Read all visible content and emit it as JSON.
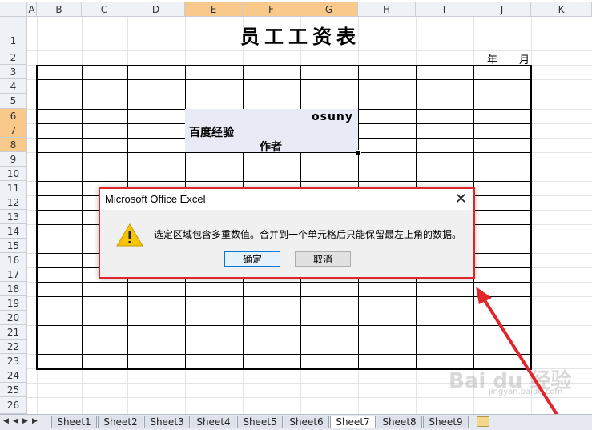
{
  "columns": [
    "A",
    "B",
    "C",
    "D",
    "E",
    "F",
    "G",
    "H",
    "I",
    "J",
    "K"
  ],
  "selected_columns": [
    "E",
    "F",
    "G"
  ],
  "rows": [
    "1",
    "2",
    "3",
    "4",
    "5",
    "6",
    "7",
    "8",
    "9",
    "10",
    "11",
    "12",
    "13",
    "14",
    "15",
    "16",
    "17",
    "18",
    "19",
    "20",
    "21",
    "22",
    "23",
    "24",
    "25",
    "26"
  ],
  "selected_rows": [
    "6",
    "7",
    "8"
  ],
  "sheet": {
    "title": "员工工资表",
    "year_label": "年",
    "month_label": "月",
    "cell_G6": "osuny",
    "cell_E7": "百度经验",
    "cell_F8": "作者"
  },
  "tabs": [
    "Sheet1",
    "Sheet2",
    "Sheet3",
    "Sheet4",
    "Sheet5",
    "Sheet6",
    "Sheet7",
    "Sheet8",
    "Sheet9"
  ],
  "active_tab": "Sheet7",
  "dialog": {
    "title": "Microsoft Office Excel",
    "close_glyph": "✕",
    "icon": "warning-icon",
    "message": "选定区域包含多重数值。合并到一个单元格后只能保留最左上角的数据。",
    "ok_label": "确定",
    "cancel_label": "取消"
  },
  "annotation": {
    "highlight_color": "#e0262a",
    "arrow_color": "#e0262a"
  },
  "watermark": {
    "text": "Bai du 经验",
    "url": "jingyan.baidu.com"
  }
}
